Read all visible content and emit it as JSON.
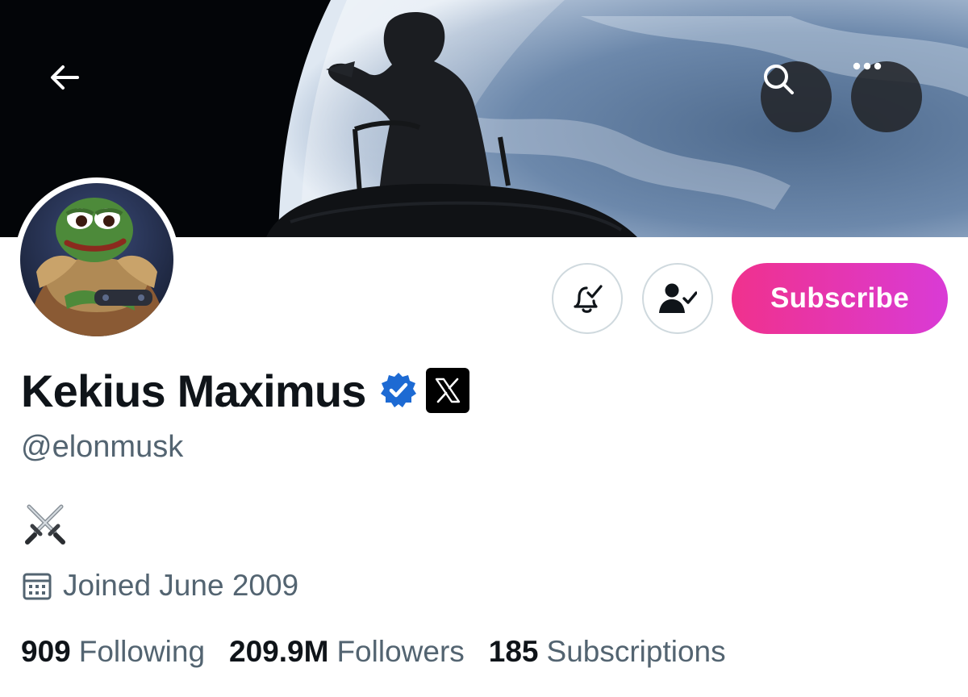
{
  "banner": {
    "description": ""
  },
  "header": {
    "back_icon": "arrow-left-icon",
    "search_icon": "search-icon",
    "more_icon": "more-horizontal-icon"
  },
  "actions": {
    "notify_icon": "bell-check-icon",
    "following_icon": "person-check-icon",
    "subscribe_label": "Subscribe"
  },
  "profile": {
    "display_name": "Kekius Maximus",
    "handle": "@elonmusk",
    "bio_emoji": "crossed-swords-icon",
    "joined": "Joined June 2009",
    "joined_icon": "calendar-icon"
  },
  "stats": {
    "following_count": "909",
    "following_label": "Following",
    "followers_count": "209.9M",
    "followers_label": "Followers",
    "subscriptions_count": "185",
    "subscriptions_label": "Subscriptions"
  },
  "colors": {
    "subscribe_gradient_start": "#f0318d",
    "subscribe_gradient_end": "#d93bd6",
    "verified_blue": "#1d9bf0",
    "text_primary": "#0f1419",
    "text_secondary": "#536471"
  }
}
